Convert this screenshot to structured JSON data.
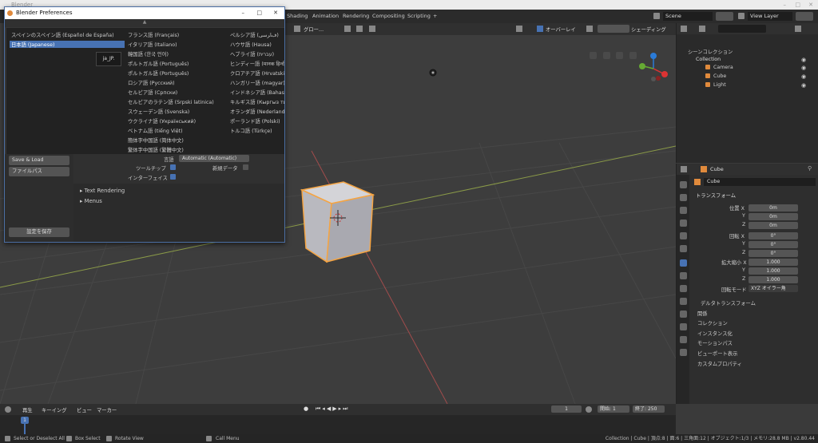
{
  "app": {
    "title": "Blender"
  },
  "topbar": {
    "workspaces": [
      "Shading",
      "Animation",
      "Rendering",
      "Compositing",
      "Scripting",
      "+"
    ],
    "scene": "Scene",
    "view_layer": "View Layer"
  },
  "viewport_header": {
    "global": "グロー…",
    "overlay": "オーバーレイ",
    "shading": "シェーディング"
  },
  "prefs": {
    "title": "Blender Preferences",
    "languages_col1": [
      "スペインのスペイン語 (Español de España)",
      "日本語 (Japanese)",
      "ja_JP."
    ],
    "languages_col2": [
      "フランス語 (Français)",
      "イタリア語 (Italiano)",
      "韓国語 (한국 언어)",
      "ポルトガル語 (Português)",
      "ポルトガル語 (Português)",
      "ロシア語 (Русский)",
      "セルビア語 (Српски)",
      "セルビアのラテン語 (Srpski latinica)",
      "スウェーデン語 (Svenska)",
      "ウクライナ語 (Український)",
      "ベトナム語 (tiếng Việt)",
      "簡体字中国語 (简体中文)",
      "繁体字中国語 (繁體中文)"
    ],
    "languages_col3": [
      "ペルシア語 (ﻑﺎﺮﺳﯽ)",
      "ハウサ語 (Hausa)",
      "ヘブライ語 (עברית)",
      "ヒンディー語 (मानक हिन्दी)",
      "クロアチア語 (Hrvatski)",
      "ハンガリー語 (magyar)",
      "インドネシア語 (Bahasa indo)",
      "キルギス語 (Кыргыз тили)",
      "オランダ語 (Nederlandse ta)",
      "ポーランド語 (Polski)",
      "トルコ語 (Türkçe)"
    ],
    "sidebar": [
      "Save & Load",
      "ファイルパス"
    ],
    "save_button": "設定を保存",
    "language_label": "言語",
    "language_value": "Automatic (Automatic)",
    "tooltips_label": "ツールチップ",
    "new_data_label": "新規データ",
    "interface_label": "インターフェイス",
    "sections": [
      "Text Rendering",
      "Menus"
    ]
  },
  "outliner": {
    "title": "シーンコレクション",
    "items": [
      "Collection",
      "Camera",
      "Cube",
      "Light"
    ]
  },
  "properties": {
    "object_name": "Cube",
    "field_name": "Cube",
    "transform": "トランスフォーム",
    "location_label": "位置 X",
    "rotation_label": "回転 X",
    "scale_label": "拡大縮小 X",
    "axis_y": "Y",
    "axis_z": "Z",
    "location": [
      "0m",
      "0m",
      "0m"
    ],
    "rotation": [
      "0°",
      "0°",
      "0°"
    ],
    "scale": [
      "1.000",
      "1.000",
      "1.000"
    ],
    "rotation_mode_label": "回転モード",
    "rotation_mode": "XYZ オイラー角",
    "delta": "デルタトランスフォーム",
    "panels": [
      "関係",
      "コレクション",
      "インスタンス化",
      "モーションパス",
      "ビューポート表示",
      "カスタムプロパティ"
    ]
  },
  "timeline": {
    "menus": [
      "再生",
      "キーイング",
      "ビュー",
      "マーカー"
    ],
    "current_frame": "1",
    "start_label": "開始:",
    "start": "1",
    "end_label": "終了:",
    "end": "250",
    "ruler_frame": "1"
  },
  "status": {
    "left": [
      "Select or Deselect All",
      "Box Select",
      "Rotate View",
      "Call Menu"
    ],
    "right": "Collection | Cube | 頂点:8 | 面:6 | 三角面:12 | オブジェクト:1/3 | メモリ:28.8 MB | v2.80.44"
  },
  "colors": {
    "accent": "#4772b3",
    "annotation": "#c8191c",
    "selection": "#f5a442"
  }
}
